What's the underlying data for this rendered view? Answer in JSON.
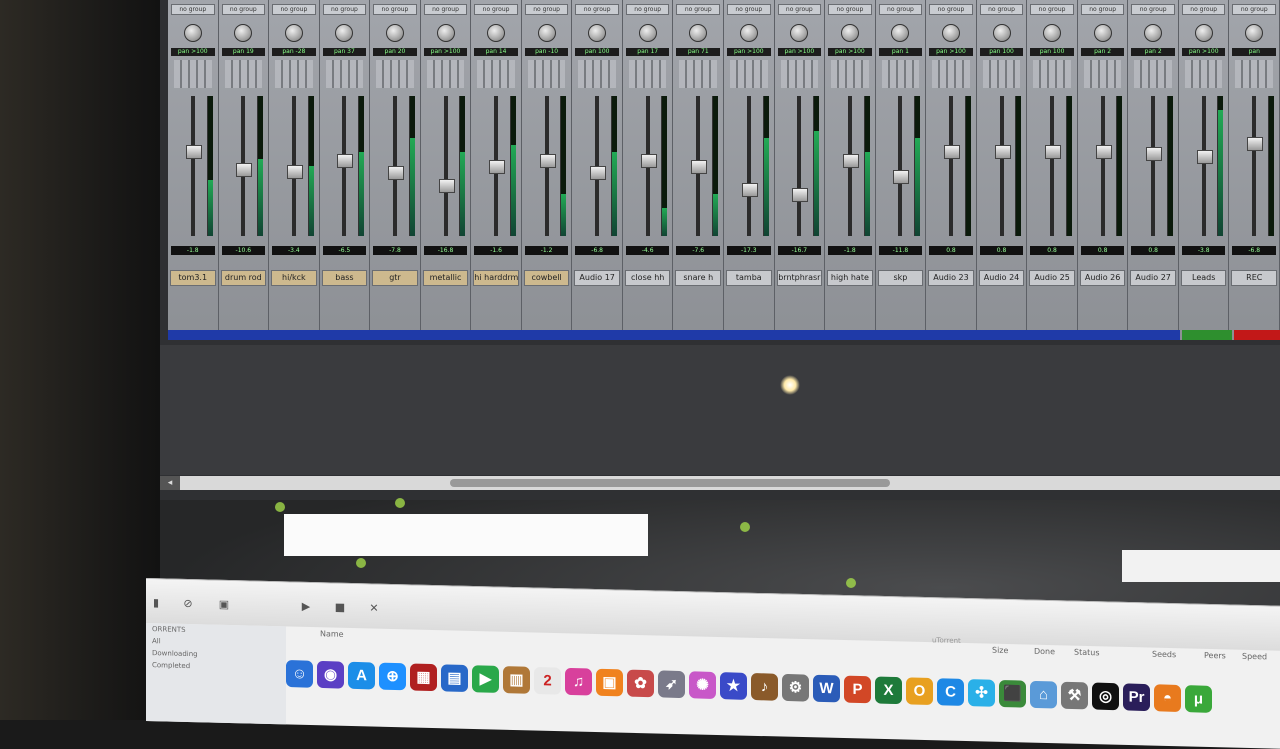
{
  "mixer": {
    "group_label": "no group",
    "strips": [
      {
        "name": "tom3.1",
        "vol": "-1.8",
        "pan": "pan >100",
        "fader": 0.62,
        "meter": 0.4,
        "tint": true
      },
      {
        "name": "drum rod",
        "vol": "-10.6",
        "pan": "pan 19",
        "fader": 0.48,
        "meter": 0.55,
        "tint": true
      },
      {
        "name": "hi/kck",
        "vol": "-3.4",
        "pan": "pan -28",
        "fader": 0.46,
        "meter": 0.5,
        "tint": true
      },
      {
        "name": "bass",
        "vol": "-6.5",
        "pan": "pan 37",
        "fader": 0.55,
        "meter": 0.6,
        "tint": true
      },
      {
        "name": "gtr",
        "vol": "-7.8",
        "pan": "pan 20",
        "fader": 0.45,
        "meter": 0.7,
        "tint": true
      },
      {
        "name": "metallic",
        "vol": "-16.8",
        "pan": "pan >100",
        "fader": 0.35,
        "meter": 0.6,
        "tint": true
      },
      {
        "name": "hi harddrm",
        "vol": "-1.6",
        "pan": "pan 14",
        "fader": 0.5,
        "meter": 0.65,
        "tint": true
      },
      {
        "name": "cowbell",
        "vol": "-1.2",
        "pan": "pan -10",
        "fader": 0.55,
        "meter": 0.3,
        "tint": true
      },
      {
        "name": "Audio 17",
        "vol": "-6.8",
        "pan": "pan 100",
        "fader": 0.45,
        "meter": 0.6,
        "tint": false
      },
      {
        "name": "close hh",
        "vol": "-4.6",
        "pan": "pan 17",
        "fader": 0.55,
        "meter": 0.2,
        "tint": false
      },
      {
        "name": "snare h",
        "vol": "-7.6",
        "pan": "pan 71",
        "fader": 0.5,
        "meter": 0.3,
        "tint": false
      },
      {
        "name": "tamba",
        "vol": "-17.3",
        "pan": "pan >100",
        "fader": 0.32,
        "meter": 0.7,
        "tint": false
      },
      {
        "name": "brntphrasr",
        "vol": "-16.7",
        "pan": "pan >100",
        "fader": 0.28,
        "meter": 0.75,
        "tint": false
      },
      {
        "name": "high hate",
        "vol": "-1.8",
        "pan": "pan >100",
        "fader": 0.55,
        "meter": 0.6,
        "tint": false
      },
      {
        "name": "skp",
        "vol": "-11.8",
        "pan": "pan 1",
        "fader": 0.42,
        "meter": 0.7,
        "tint": false
      },
      {
        "name": "Audio 23",
        "vol": "0.8",
        "pan": "pan >100",
        "fader": 0.62,
        "meter": 0.0,
        "tint": false
      },
      {
        "name": "Audio 24",
        "vol": "0.8",
        "pan": "pan 100",
        "fader": 0.62,
        "meter": 0.0,
        "tint": false
      },
      {
        "name": "Audio 25",
        "vol": "0.8",
        "pan": "pan 100",
        "fader": 0.62,
        "meter": 0.0,
        "tint": false
      },
      {
        "name": "Audio 26",
        "vol": "0.8",
        "pan": "pan 2",
        "fader": 0.62,
        "meter": 0.0,
        "tint": false
      },
      {
        "name": "Audio 27",
        "vol": "0.8",
        "pan": "pan 2",
        "fader": 0.6,
        "meter": 0.0,
        "tint": false
      },
      {
        "name": "Leads",
        "vol": "-3.8",
        "pan": "pan >100",
        "fader": 0.58,
        "meter": 0.9,
        "tint": false
      },
      {
        "name": "REC",
        "vol": "-6.8",
        "pan": "pan",
        "fader": 0.68,
        "meter": 0.0,
        "tint": false
      }
    ]
  },
  "torrent": {
    "sidebar": [
      "ORRENTS",
      "All",
      "Downloading",
      "Completed"
    ],
    "columns": {
      "name": "Name",
      "size": "Size",
      "done": "Done",
      "status": "Status",
      "seeds": "Seeds",
      "peers": "Peers",
      "speed": "Speed"
    },
    "search_placeholder": "uTorrent"
  },
  "dock": {
    "icons": [
      {
        "name": "finder-icon",
        "glyph": "☺",
        "color": "#2a72d8"
      },
      {
        "name": "siri-icon",
        "glyph": "◉",
        "color": "#5b3fc4"
      },
      {
        "name": "app-store-icon",
        "glyph": "A",
        "color": "#1c8ee8"
      },
      {
        "name": "safari-icon",
        "glyph": "⊕",
        "color": "#1e90ff"
      },
      {
        "name": "photo-booth-icon",
        "glyph": "▦",
        "color": "#b02020"
      },
      {
        "name": "preview-icon",
        "glyph": "▤",
        "color": "#2868c8"
      },
      {
        "name": "facetime-icon",
        "glyph": "▶",
        "color": "#2aa84a"
      },
      {
        "name": "notes-icon",
        "glyph": "▥",
        "color": "#b07838"
      },
      {
        "name": "calendar-icon",
        "glyph": "2",
        "color": "#e8e8e8"
      },
      {
        "name": "itunes-icon",
        "glyph": "♫",
        "color": "#d8409c"
      },
      {
        "name": "books-icon",
        "glyph": "▣",
        "color": "#f0821e"
      },
      {
        "name": "photos-icon",
        "glyph": "✿",
        "color": "#c84a4a"
      },
      {
        "name": "rocket-icon",
        "glyph": "➶",
        "color": "#7a7a8a"
      },
      {
        "name": "color-picker-icon",
        "glyph": "✺",
        "color": "#c858c8"
      },
      {
        "name": "imovie-icon",
        "glyph": "★",
        "color": "#3a4ac8"
      },
      {
        "name": "guitar-icon",
        "glyph": "♪",
        "color": "#8a5a2a"
      },
      {
        "name": "settings-icon",
        "glyph": "⚙",
        "color": "#777777"
      },
      {
        "name": "word-icon",
        "glyph": "W",
        "color": "#2b5cb8"
      },
      {
        "name": "powerpoint-icon",
        "glyph": "P",
        "color": "#d24726"
      },
      {
        "name": "excel-icon",
        "glyph": "X",
        "color": "#1e7a3a"
      },
      {
        "name": "outlook-icon",
        "glyph": "O",
        "color": "#e8a020"
      },
      {
        "name": "c-app-icon",
        "glyph": "C",
        "color": "#1e88e5"
      },
      {
        "name": "messenger-icon",
        "glyph": "✣",
        "color": "#2ab0e8"
      },
      {
        "name": "box-icon",
        "glyph": "⬛",
        "color": "#3a8a3a"
      },
      {
        "name": "folder-icon",
        "glyph": "⌂",
        "color": "#5a9ad8"
      },
      {
        "name": "tools-icon",
        "glyph": "⚒",
        "color": "#777777"
      },
      {
        "name": "eclipse-icon",
        "glyph": "◎",
        "color": "#101010"
      },
      {
        "name": "premiere-icon",
        "glyph": "Pr",
        "color": "#2a1e5a"
      },
      {
        "name": "firefox-icon",
        "glyph": "◓",
        "color": "#e87a1e"
      },
      {
        "name": "utorrent-icon",
        "glyph": "μ",
        "color": "#3aa83a"
      }
    ]
  },
  "colors": {
    "record": "#c21818",
    "mixer_blue": "#1f3aa8"
  }
}
